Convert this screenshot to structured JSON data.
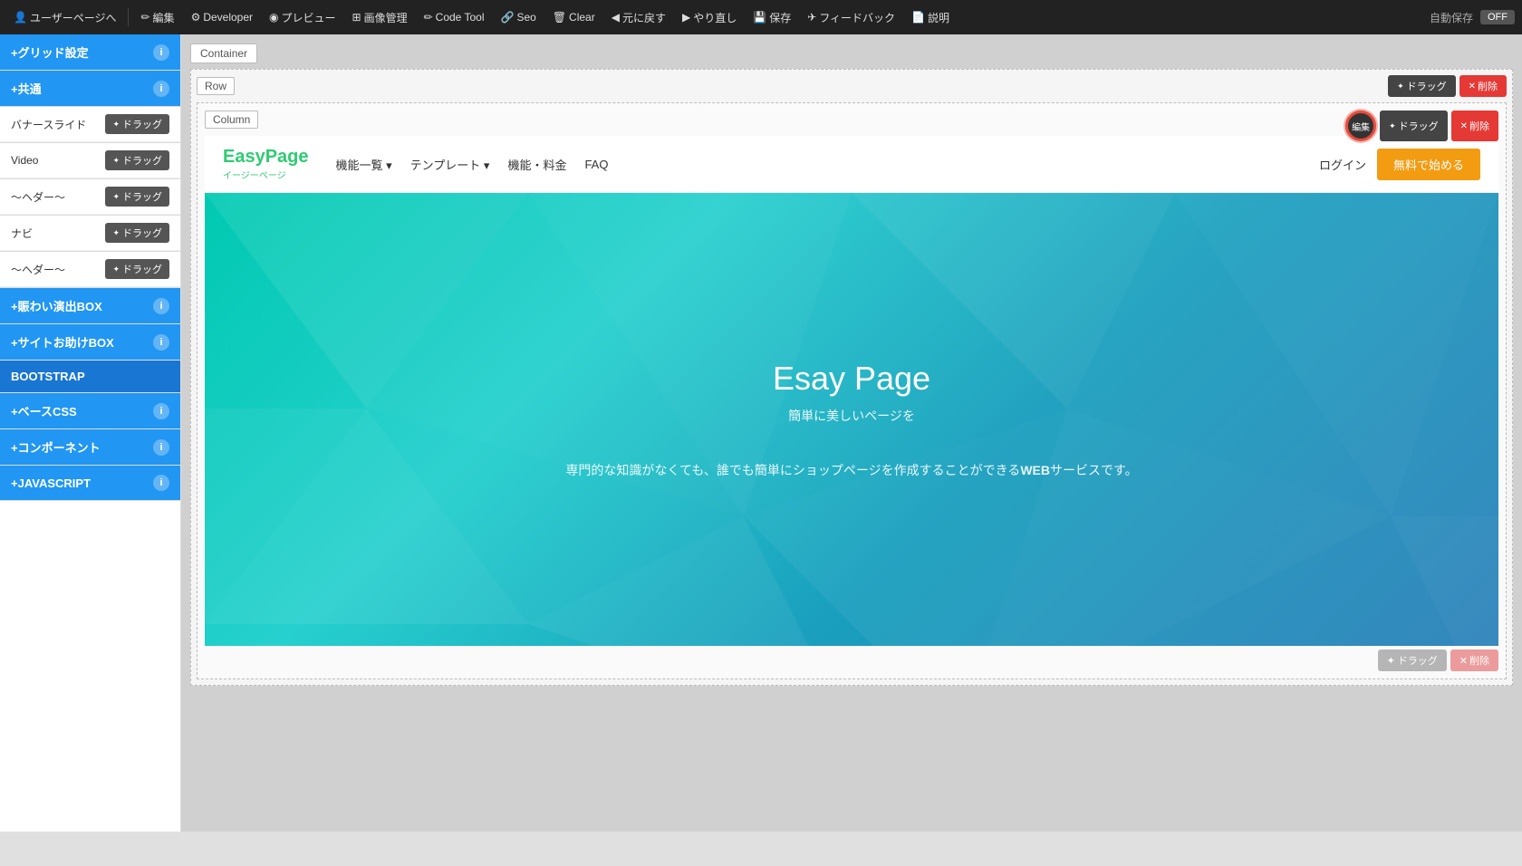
{
  "toolbar": {
    "items": [
      {
        "id": "user-page",
        "label": "ユーザーページへ",
        "icon": "👤"
      },
      {
        "id": "edit",
        "label": "編集",
        "icon": "✏️"
      },
      {
        "id": "developer",
        "label": "Developer",
        "icon": "🔧"
      },
      {
        "id": "preview",
        "label": "プレビュー",
        "icon": "👁"
      },
      {
        "id": "image-manage",
        "label": "画像管理",
        "icon": "🖼"
      },
      {
        "id": "code-tool",
        "label": "Code Tool",
        "icon": "✏️"
      },
      {
        "id": "seo",
        "label": "Seo",
        "icon": "🔗"
      },
      {
        "id": "clear",
        "label": "Clear",
        "icon": "🗑"
      },
      {
        "id": "undo",
        "label": "元に戻す",
        "icon": "◀"
      },
      {
        "id": "redo",
        "label": "やり直し",
        "icon": "▶"
      },
      {
        "id": "save",
        "label": "保存",
        "icon": "💾"
      },
      {
        "id": "feedback",
        "label": "フィードバック",
        "icon": "✈"
      },
      {
        "id": "description",
        "label": "説明",
        "icon": "📄"
      }
    ],
    "autosave_label": "自動保存",
    "autosave_value": "OFF"
  },
  "sidebar": {
    "sections": [
      {
        "id": "grid",
        "label": "+グリッド設定",
        "type": "header-only",
        "has_info": true
      },
      {
        "id": "common",
        "label": "+共通",
        "type": "header-only",
        "has_info": true
      },
      {
        "id": "banner-slide",
        "label": "バナースライド",
        "type": "drag-item",
        "drag_label": "ドラッグ"
      },
      {
        "id": "video",
        "label": "Video",
        "type": "drag-item",
        "drag_label": "ドラッグ"
      },
      {
        "id": "header1",
        "label": "〜ヘダー〜",
        "type": "drag-item",
        "drag_label": "ドラッグ"
      },
      {
        "id": "navi",
        "label": "ナビ",
        "type": "drag-item",
        "drag_label": "ドラッグ"
      },
      {
        "id": "header2",
        "label": "〜ヘダー〜",
        "type": "drag-item",
        "drag_label": "ドラッグ"
      },
      {
        "id": "popup-box",
        "label": "+賑わい演出BOX",
        "type": "header-section",
        "has_info": true
      },
      {
        "id": "site-help-box",
        "label": "+サイトお助けBOX",
        "type": "header-section",
        "has_info": true
      },
      {
        "id": "bootstrap",
        "label": "BOOTSTRAP",
        "type": "header-only-dark"
      },
      {
        "id": "base-css",
        "label": "+ベースCSS",
        "type": "header-section",
        "has_info": true
      },
      {
        "id": "component",
        "label": "+コンポーネント",
        "type": "header-section",
        "has_info": true
      },
      {
        "id": "javascript",
        "label": "+JAVASCRIPT",
        "type": "header-section",
        "has_info": true
      }
    ]
  },
  "builder": {
    "container_label": "Container",
    "row_label": "Row",
    "column_label": "Column",
    "drag_btn": "ドラッグ",
    "delete_btn": "削除",
    "edit_btn": "編集"
  },
  "navbar": {
    "brand": "EasyPage",
    "brand_sub": "イージーページ",
    "links": [
      {
        "label": "機能一覧",
        "dropdown": true
      },
      {
        "label": "テンプレート",
        "dropdown": true
      },
      {
        "label": "機能・料金"
      },
      {
        "label": "FAQ"
      }
    ],
    "login": "ログイン",
    "cta": "無料で始める"
  },
  "hero": {
    "title": "Esay Page",
    "subtitle": "簡単に美しいページを",
    "description": "専門的な知識がなくても、誰でも簡単にショップページを作成することができるWEBサービスです。",
    "description_bold": "WEB"
  }
}
